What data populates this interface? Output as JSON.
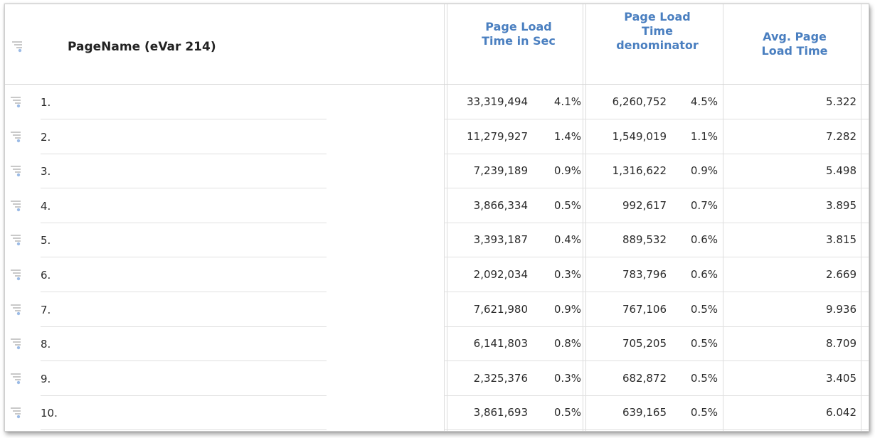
{
  "table": {
    "dimension_header": "PageName (eVar 214)",
    "metric_headers": [
      [
        "Page Load",
        "Time in Sec"
      ],
      [
        "Page Load",
        "Time",
        "denominator"
      ],
      [
        "Avg. Page",
        "Load Time"
      ]
    ],
    "rows": [
      {
        "rank": "1.",
        "load_time": "33,319,494",
        "load_time_pct": "4.1%",
        "denominator": "6,260,752",
        "denominator_pct": "4.5%",
        "avg": "5.322"
      },
      {
        "rank": "2.",
        "load_time": "11,279,927",
        "load_time_pct": "1.4%",
        "denominator": "1,549,019",
        "denominator_pct": "1.1%",
        "avg": "7.282"
      },
      {
        "rank": "3.",
        "load_time": "7,239,189",
        "load_time_pct": "0.9%",
        "denominator": "1,316,622",
        "denominator_pct": "0.9%",
        "avg": "5.498"
      },
      {
        "rank": "4.",
        "load_time": "3,866,334",
        "load_time_pct": "0.5%",
        "denominator": "992,617",
        "denominator_pct": "0.7%",
        "avg": "3.895"
      },
      {
        "rank": "5.",
        "load_time": "3,393,187",
        "load_time_pct": "0.4%",
        "denominator": "889,532",
        "denominator_pct": "0.6%",
        "avg": "3.815"
      },
      {
        "rank": "6.",
        "load_time": "2,092,034",
        "load_time_pct": "0.3%",
        "denominator": "783,796",
        "denominator_pct": "0.6%",
        "avg": "2.669"
      },
      {
        "rank": "7.",
        "load_time": "7,621,980",
        "load_time_pct": "0.9%",
        "denominator": "767,106",
        "denominator_pct": "0.5%",
        "avg": "9.936"
      },
      {
        "rank": "8.",
        "load_time": "6,141,803",
        "load_time_pct": "0.8%",
        "denominator": "705,205",
        "denominator_pct": "0.5%",
        "avg": "8.709"
      },
      {
        "rank": "9.",
        "load_time": "2,325,376",
        "load_time_pct": "0.3%",
        "denominator": "682,872",
        "denominator_pct": "0.5%",
        "avg": "3.405"
      },
      {
        "rank": "10.",
        "load_time": "3,861,693",
        "load_time_pct": "0.5%",
        "denominator": "639,165",
        "denominator_pct": "0.5%",
        "avg": "6.042"
      }
    ]
  },
  "colors": {
    "metric_header": "#4a7fc0",
    "breakdown_icon": "#c4c4c4",
    "breakdown_icon_dot": "#6b9be0"
  },
  "icons": {
    "breakdown": "breakdown-icon"
  }
}
